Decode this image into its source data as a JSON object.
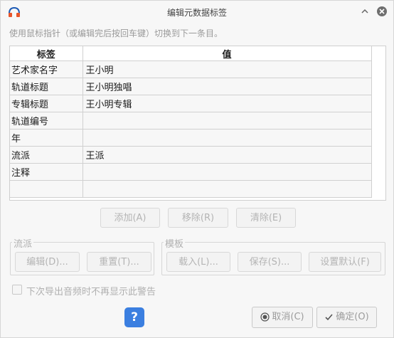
{
  "window": {
    "title": "编辑元数据标签"
  },
  "hint": "使用鼠标指针（或编辑完后按回车键）切换到下一条目。",
  "table": {
    "headers": [
      "标签",
      "值"
    ],
    "rows": [
      [
        "艺术家名字",
        "王小明"
      ],
      [
        "轨道标题",
        "王小明独唱"
      ],
      [
        "专辑标题",
        "王小明专辑"
      ],
      [
        "轨道编号",
        ""
      ],
      [
        "年",
        ""
      ],
      [
        "流派",
        "王派"
      ],
      [
        "注释",
        ""
      ],
      [
        "",
        ""
      ]
    ]
  },
  "row_buttons": {
    "add": "添加(A)",
    "remove": "移除(R)",
    "clear": "清除(E)"
  },
  "genre_group": {
    "title": "流派",
    "edit": "编辑(D)...",
    "reset": "重置(T)..."
  },
  "template_group": {
    "title": "模板",
    "load": "载入(L)...",
    "save": "保存(S)...",
    "set_default": "设置默认(F)"
  },
  "checkbox": {
    "label": "下次导出音频时不再显示此警告",
    "checked": false
  },
  "footer": {
    "help": "?",
    "cancel": "取消(C)",
    "ok": "确定(O)"
  },
  "icons": {
    "app": "headphones-icon",
    "minimize": "chevron-up-icon",
    "close": "close-icon",
    "cancel": "radio-cancel-icon",
    "ok": "checkmark-icon"
  },
  "colors": {
    "accent": "#3b7fe0",
    "app_icon": "#e8552a"
  }
}
